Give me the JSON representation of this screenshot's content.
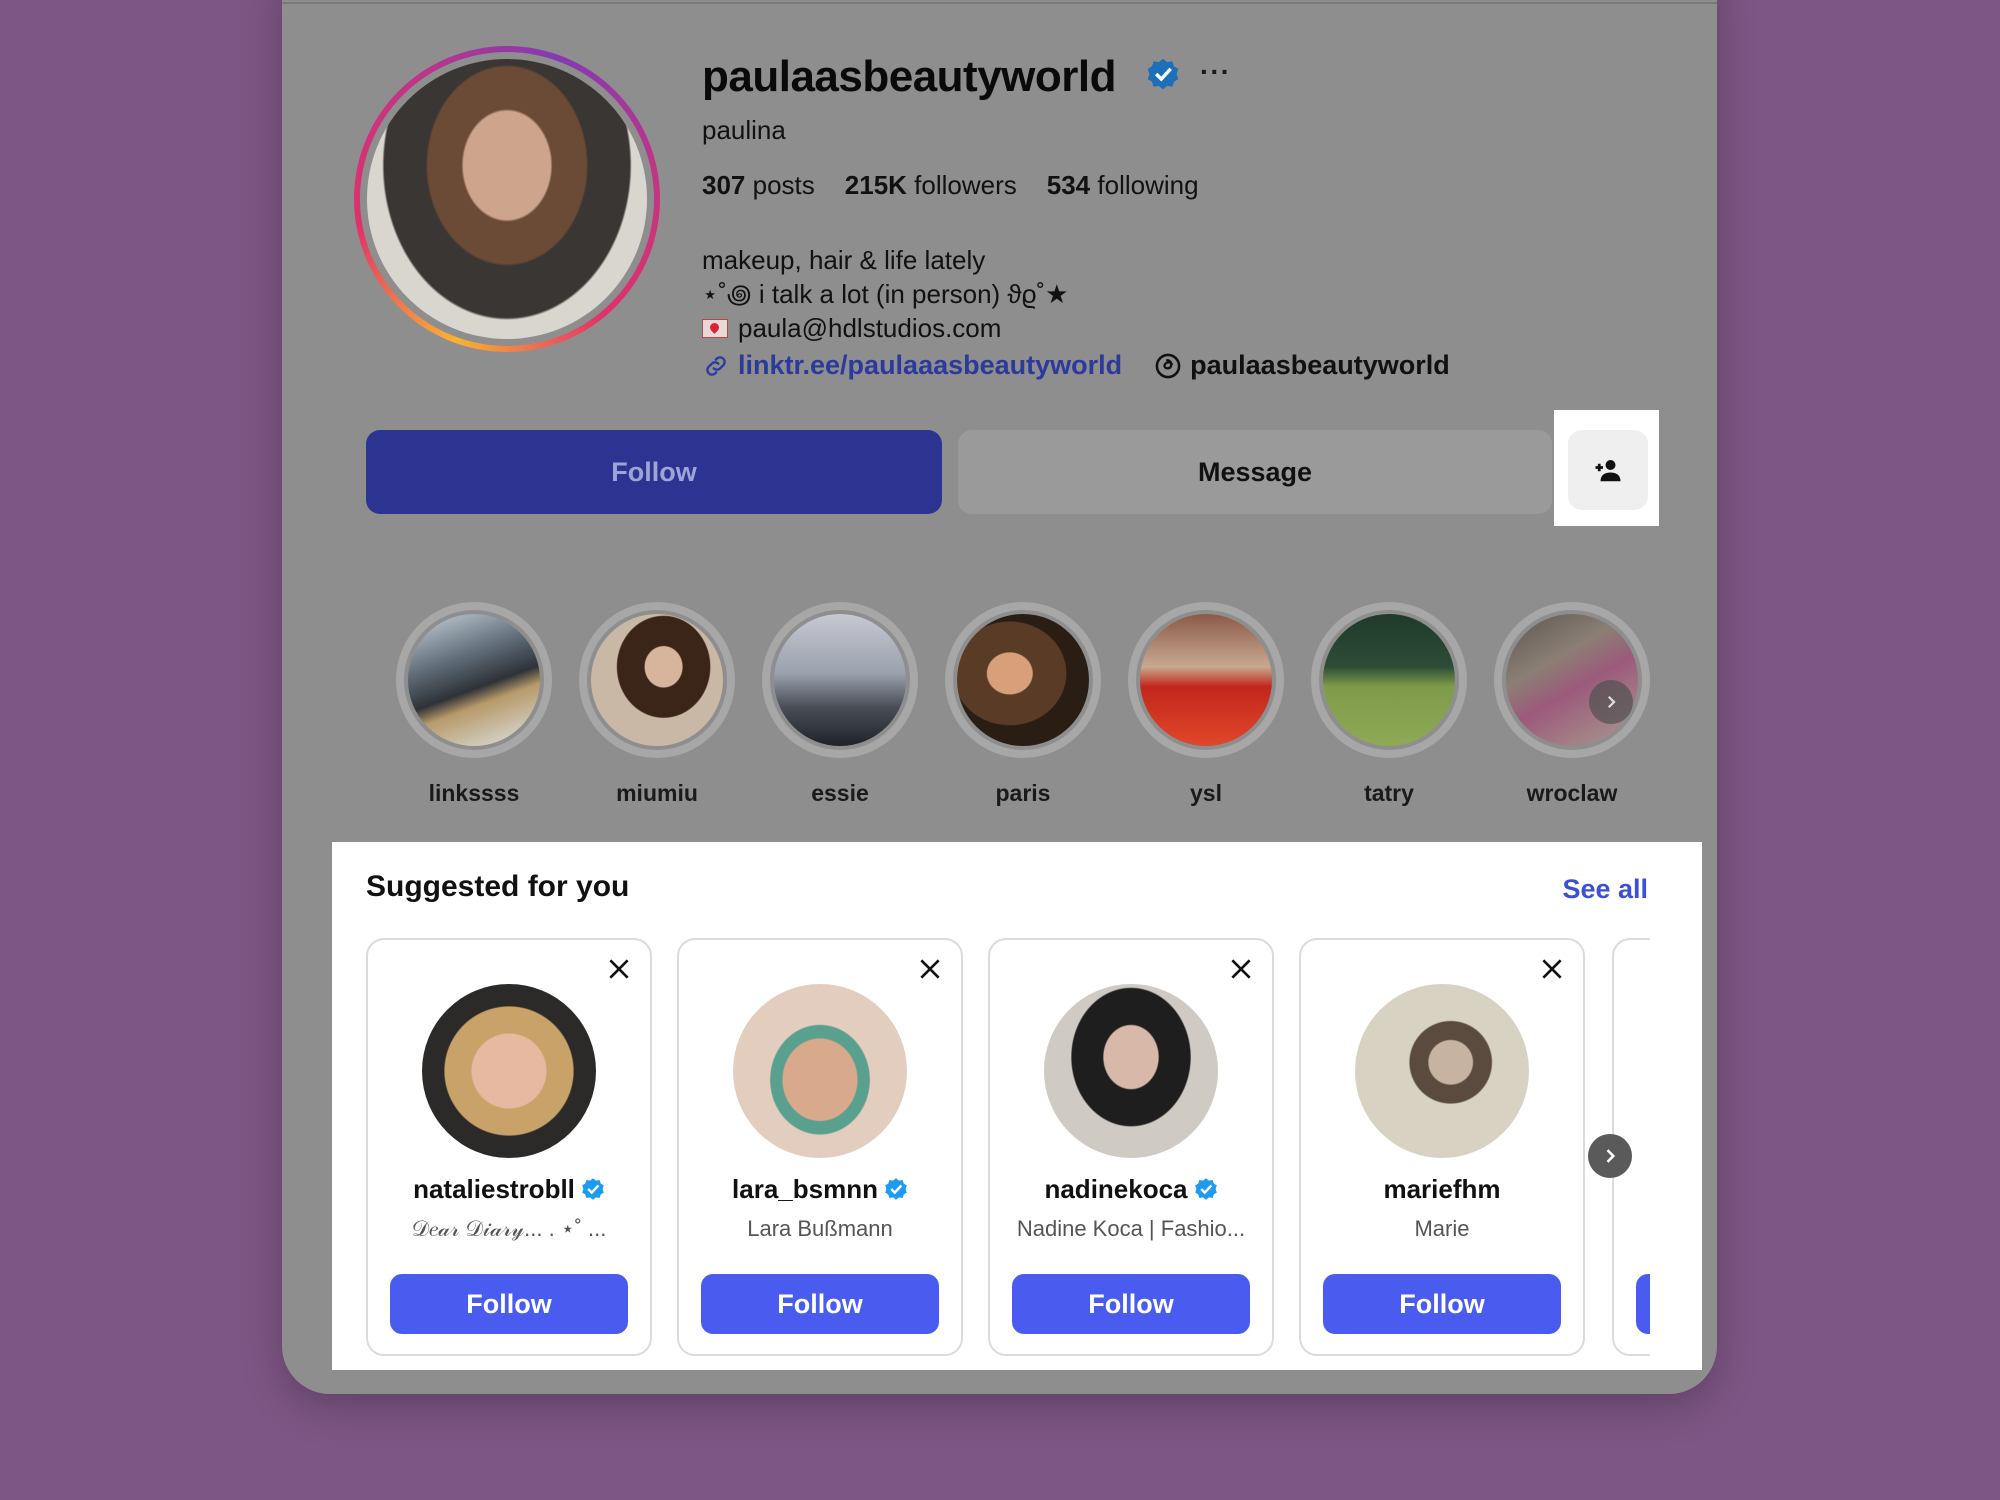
{
  "profile": {
    "username": "paulaasbeautyworld",
    "full_name": "paulina",
    "posts_count": "307",
    "posts_label": "posts",
    "followers_count": "215K",
    "followers_label": "followers",
    "following_count": "534",
    "following_label": "following",
    "bio": {
      "line1": "makeup, hair & life lately",
      "line2": "⋆˚꩜ i talk a lot (in person) ϑϱ˚★",
      "line3": "paula@hdlstudios.com"
    },
    "link": "linktr.ee/paulaaasbeautyworld",
    "threads_handle": "paulaasbeautyworld",
    "more_label": "···"
  },
  "actions": {
    "follow_label": "Follow",
    "message_label": "Message",
    "suggest_icon": "person-add-icon"
  },
  "highlights": [
    {
      "label": "linkssss"
    },
    {
      "label": "miumiu"
    },
    {
      "label": "essie"
    },
    {
      "label": "paris"
    },
    {
      "label": "ysl"
    },
    {
      "label": "tatry"
    },
    {
      "label": "wroclaw"
    }
  ],
  "suggested": {
    "title": "Suggested for you",
    "see_all": "See all",
    "cards": [
      {
        "username": "nataliestrobll",
        "verified": true,
        "subtitle": "𝒟𝑒𝒶𝓇 𝒟𝒾𝒶𝓇𝓎... . ⋆˚ ...",
        "button": "Follow"
      },
      {
        "username": "lara_bsmnn",
        "verified": true,
        "subtitle": "Lara Bußmann",
        "button": "Follow"
      },
      {
        "username": "nadinekoca",
        "verified": true,
        "subtitle": "Nadine Koca | Fashio...",
        "button": "Follow"
      },
      {
        "username": "mariefhm",
        "verified": false,
        "subtitle": "Marie",
        "button": "Follow"
      }
    ]
  },
  "colors": {
    "background": "#7e5685",
    "overlay": "#8e8e8e",
    "follow_primary_dim": "#2c3390",
    "follow_button": "#4a5cf0",
    "link": "#2b3a9c",
    "see_all": "#3b4fd8",
    "verified": "#1d9bf0"
  }
}
